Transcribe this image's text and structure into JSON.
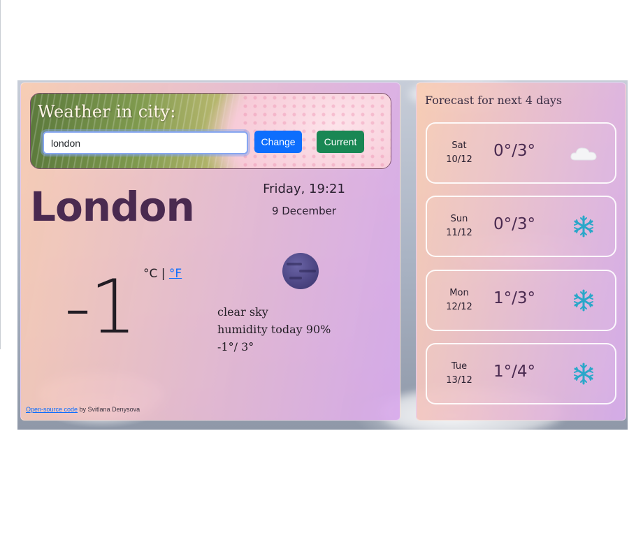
{
  "search": {
    "title": "Weather in city:",
    "input_value": "london",
    "change_label": "Change",
    "current_label": "Current"
  },
  "current": {
    "city": "London",
    "day_time": "Friday, 19:21",
    "date": "9 December",
    "temperature": "-1",
    "unit_c": "°C",
    "unit_separator": "|",
    "unit_f": "°F",
    "description": "clear sky",
    "humidity": "humidity today 90%",
    "min_max": "-1°/ 3°",
    "icon": "moon-night-icon"
  },
  "footer": {
    "link_text": "Open-source code",
    "author_text": " by Svitlana Denysova"
  },
  "forecast": {
    "title": "Forecast for next 4 days",
    "days": [
      {
        "day": "Sat",
        "date": "10/12",
        "temp": "0°/3°",
        "icon": "cloud-icon"
      },
      {
        "day": "Sun",
        "date": "11/12",
        "temp": "0°/3°",
        "icon": "snowflake-icon"
      },
      {
        "day": "Mon",
        "date": "12/12",
        "temp": "1°/3°",
        "icon": "snowflake-icon"
      },
      {
        "day": "Tue",
        "date": "13/12",
        "temp": "1°/4°",
        "icon": "snowflake-icon"
      }
    ]
  },
  "colors": {
    "primary_button": "#0d6efd",
    "success_button": "#198754",
    "city_text": "#4a2a50",
    "snowflake": "#2aa7c9"
  }
}
